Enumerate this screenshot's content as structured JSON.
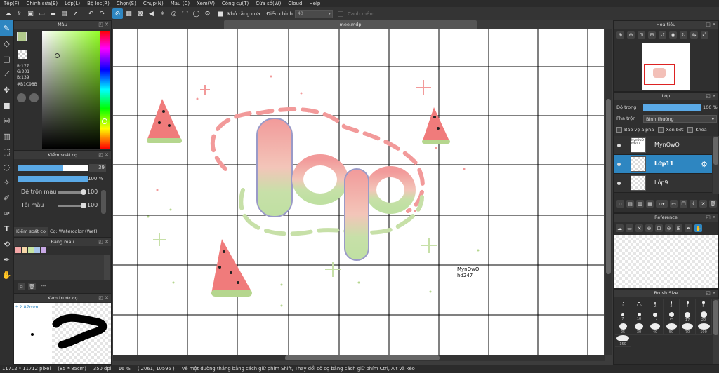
{
  "menu": [
    "Tệp(F)",
    "Chỉnh sửa(E)",
    "Lớp(L)",
    "Bộ lọc(R)",
    "Chọn(S)",
    "Chụp(N)",
    "Màu (C)",
    "Xem(V)",
    "Công cụ(T)",
    "Cửa sổ(W)",
    "Cloud",
    "Help"
  ],
  "toolbar": {
    "antialias_label": "Khử răng cưa",
    "adjust_label": "Điều chỉnh",
    "adjust_value": "40",
    "canh_mem_label": "Canh mềm"
  },
  "color_panel": {
    "title": "Màu",
    "r": "R:177",
    "g": "G:201",
    "b": "B:139",
    "hex": "#B1C98B",
    "current_color": "#B1C98B"
  },
  "brush_control": {
    "title": "Kiểm soát cọ",
    "size_value": "39",
    "opacity_value": "100 %",
    "blend_label": "Dễ trộn màu",
    "blend_value": "100",
    "reload_label": "Tải màu",
    "reload_value": "100",
    "tab1": "Kiểm soát cọ",
    "tab2": "Cọ: Watercolor (Wet)"
  },
  "palette": {
    "title": "Bảng màu",
    "swatches": [
      "#f4a7a7",
      "#f6d7a8",
      "#c6e3a1",
      "#a9c6ea",
      "#c9a9e6"
    ],
    "more": "---"
  },
  "brush_preview": {
    "title": "Xem trước cọ",
    "size": "* 2.87mm"
  },
  "document": {
    "tab": "mee.mdp",
    "signature_line1": "MynOwO",
    "signature_line2": "hd247"
  },
  "navigator": {
    "title": "Hoa tiêu"
  },
  "layers": {
    "title": "Lớp",
    "opacity_label": "Độ trong",
    "opacity_value": "100 %",
    "blend_label": "Pha trộn",
    "blend_value": "Bình thường",
    "protect_alpha": "Bảo vệ alpha",
    "clipping": "Xén bớt",
    "lock": "Khóa",
    "items": [
      {
        "name": "MynOwO",
        "thumb": "MynOwO hd247"
      },
      {
        "name": "Lớp11",
        "thumb": ""
      },
      {
        "name": "Lớp9",
        "thumb": ""
      }
    ]
  },
  "reference": {
    "title": "Reference"
  },
  "brush_size": {
    "title": "Brush Size",
    "sizes": [
      "1",
      "1.5",
      "2",
      "3",
      "4",
      "5",
      "7",
      "10",
      "12",
      "15",
      "17",
      "20",
      "25",
      "30",
      "40",
      "50",
      "70",
      "100",
      "150"
    ]
  },
  "status": {
    "dims": "11712 * 11712 pixel",
    "cm": "(85 * 85cm)",
    "dpi": "350 dpi",
    "zoom": "16 %",
    "coords": "( 2061, 10595 )",
    "hint": "Vẽ một đường thẳng bằng cách giữ phím Shift, Thay đổi cỡ cọ bằng cách giữ phím Ctrl, Alt và kéo"
  }
}
